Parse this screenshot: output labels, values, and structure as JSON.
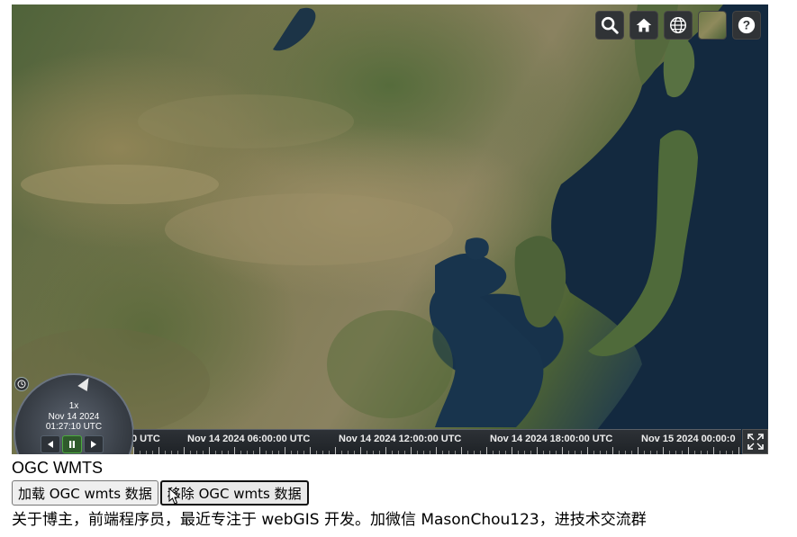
{
  "toolbar": {
    "buttons": [
      {
        "name": "search-icon",
        "title": "search"
      },
      {
        "name": "home-icon",
        "title": "home"
      },
      {
        "name": "globe-icon",
        "title": "scene mode"
      },
      {
        "name": "imagery-layer-icon",
        "title": "base layer picker"
      },
      {
        "name": "help-icon",
        "title": "help"
      }
    ]
  },
  "animation": {
    "speed": "1x",
    "date": "Nov 14 2024",
    "time": "01:27:10 UTC",
    "state": "playing"
  },
  "timeline": {
    "labels": [
      "0 UTC",
      "Nov 14 2024 06:00:00 UTC",
      "Nov 14 2024 12:00:00 UTC",
      "Nov 14 2024 18:00:00 UTC",
      "Nov 15 2024 00:00:0"
    ]
  },
  "page": {
    "title": "OGC WMTS",
    "load_button": "加载 OGC wmts 数据",
    "remove_button": "移除 OGC wmts 数据",
    "about_text": "关于博主，前端程序员，最近专注于 webGIS 开发。加微信 MasonChou123，进技术交流群"
  },
  "colors": {
    "widget_bg": "#303336",
    "play_active": "#4caa3f",
    "ocean": "#17324b"
  }
}
